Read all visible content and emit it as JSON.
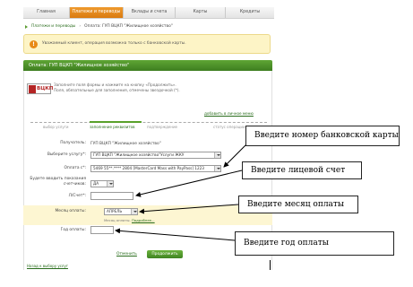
{
  "nav": {
    "tabs": [
      {
        "label": "Главная",
        "active": false
      },
      {
        "label": "Платежи и переводы",
        "active": true
      },
      {
        "label": "Вклады и счета",
        "active": false
      },
      {
        "label": "Карты",
        "active": false
      },
      {
        "label": "Кредиты",
        "active": false
      }
    ]
  },
  "breadcrumb": {
    "items": [
      "Платежи и переводы",
      "Оплата: ГУП ВЦКП \"Жилищное хозяйство\""
    ]
  },
  "notice": {
    "text": "Уважаемый клиент, операция возможна только с банковской карты."
  },
  "page": {
    "title": "Оплата: ГУП ВЦКП \"Жилищное хозяйство\"",
    "logo_text": "ВЦКП",
    "intro_line1": "Заполните поля формы и нажмите на кнопку «Продолжить».",
    "intro_line2": "Поля, обязательные для заполнения, отмечены звездочкой (*).",
    "add_personal_link": "добавить в личное меню"
  },
  "steps": [
    {
      "label": "выбор услуги",
      "active": false
    },
    {
      "label": "заполнение реквизитов",
      "active": true
    },
    {
      "label": "подтверждение",
      "active": false
    },
    {
      "label": "статус операции",
      "active": false
    }
  ],
  "form": {
    "recipient_label": "Получатель:",
    "recipient_value": "ГУП ВЦКП \"Жилищное хозяйство\"",
    "service_label": "Выберите услугу*:",
    "service_value": "ГУП ВЦКП \"Жилищное хозяйство\"Услуги ЖКУ",
    "payfrom_label": "Оплата с*:",
    "payfrom_value": "5469 55**.**** 2804 [MasterCard Mass with PayPass] 1223",
    "meter_label_1": "Будете вводить показания",
    "meter_label_2": "счетчиков:",
    "meter_value": "ДА",
    "account_label": "Л/Счет*:",
    "month_label": "Месяц оплаты:",
    "month_value": "АПРЕЛЬ",
    "month_hint": "Месяц оплаты.",
    "month_hint_link": "Подробнее...",
    "year_label": "Год оплаты:",
    "cancel": "Отменить",
    "continue": "Продолжить",
    "footer_link": "Назад к выбору услуг"
  },
  "callouts": {
    "card": "Введите номер банковской карты",
    "account": "Введите лицевой счет",
    "month": "Введите месяц оплаты",
    "year": "Введите год оплаты"
  }
}
